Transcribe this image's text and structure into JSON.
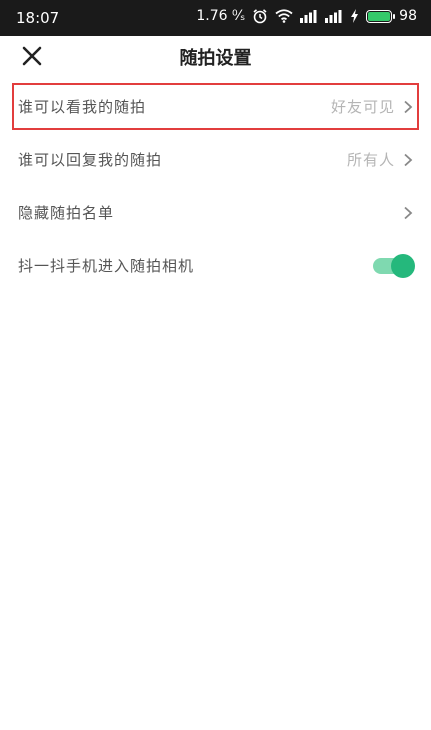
{
  "status_bar": {
    "time": "18:07",
    "net_speed": "1.76 ⁰⁄ₛ",
    "battery": "98"
  },
  "header": {
    "title": "随拍设置"
  },
  "settings": [
    {
      "label": "谁可以看我的随拍",
      "value": "好友可见",
      "highlighted": true
    },
    {
      "label": "谁可以回复我的随拍",
      "value": "所有人"
    },
    {
      "label": "隐藏随拍名单",
      "value": ""
    },
    {
      "label": "抖一抖手机进入随拍相机",
      "toggle": "on"
    }
  ],
  "colors": {
    "accent": "#25b87c",
    "highlight_border": "#e23d3d"
  }
}
